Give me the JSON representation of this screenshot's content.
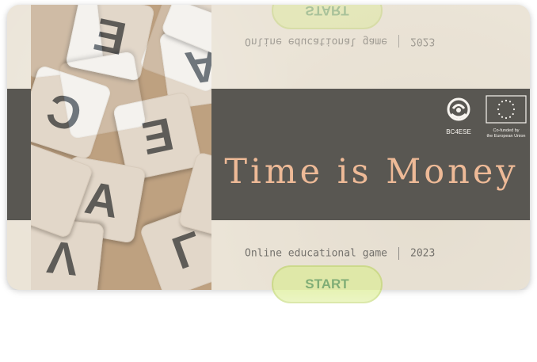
{
  "game": {
    "title": "Time is Money",
    "subtitle": "Online educational game",
    "year": "2023",
    "start_label": "START"
  },
  "logos": {
    "bc4ese_label": "BC4ESE",
    "eu_label_line1": "Co-funded by",
    "eu_label_line2": "the European Union"
  },
  "photo_tiles": [
    "E",
    "A",
    "C",
    "E",
    "A",
    "L",
    "V"
  ],
  "icons": [
    "bc4ese-logo-icon",
    "eu-flag-icon"
  ],
  "colors": {
    "title": "#f0a070",
    "band": "#000000",
    "paper": "#ebe4d7",
    "start_fill": "#d9ec8c",
    "start_text": "#3f8c3a"
  }
}
